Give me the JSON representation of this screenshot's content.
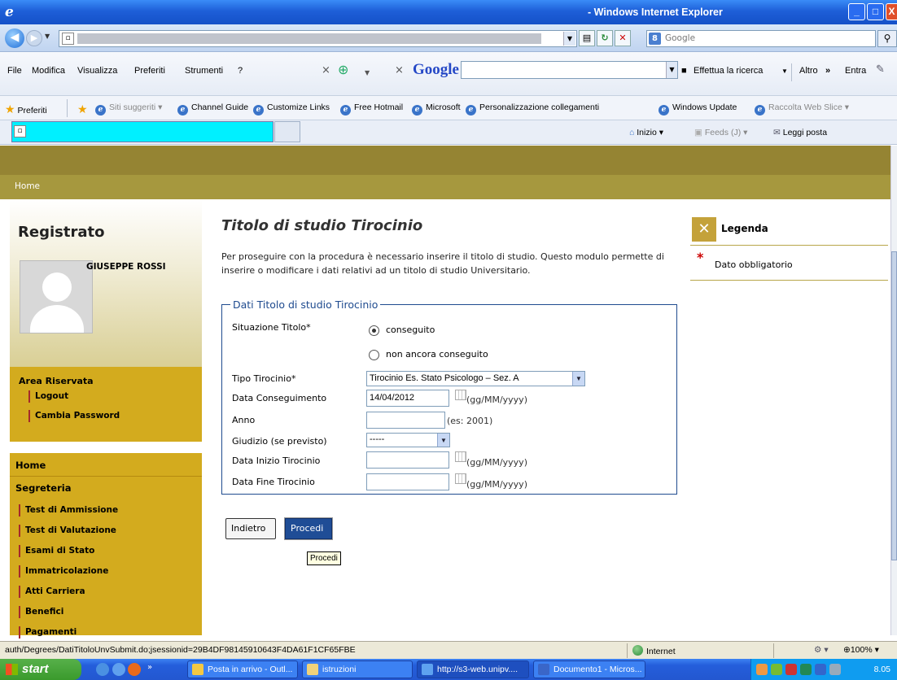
{
  "window": {
    "title": "- Windows Internet Explorer",
    "min_label": "_",
    "max_label": "□",
    "close_label": "X"
  },
  "addressbar": {
    "search_placeholder": "Google",
    "google_badge": "8"
  },
  "menubar": {
    "items": [
      "File",
      "Modifica",
      "Visualizza",
      "Preferiti",
      "Strumenti",
      "?"
    ],
    "google_label": "Google",
    "search_action": "Effettua la ricerca",
    "altro": "Altro",
    "entra": "Entra"
  },
  "favorites": {
    "label": "Preferiti",
    "items": [
      {
        "label": "Siti suggeriti",
        "dim": true
      },
      {
        "label": "Channel Guide",
        "dim": false
      },
      {
        "label": "Customize Links",
        "dim": false
      },
      {
        "label": "Free Hotmail",
        "dim": false
      },
      {
        "label": "Microsoft",
        "dim": false
      },
      {
        "label": "Personalizzazione collegamenti",
        "dim": false
      },
      {
        "label": "Windows Update",
        "dim": false
      },
      {
        "label": "Raccolta Web Slice",
        "dim": true
      }
    ]
  },
  "commandbar": {
    "home": "Inizio",
    "feeds": "Feeds (J)",
    "mail": "Leggi posta"
  },
  "page": {
    "breadcrumb": "Home",
    "sidebar": {
      "heading": "Registrato",
      "user_name": "GIUSEPPE ROSSI",
      "area_title": "Area Riservata",
      "area_links": [
        "Logout",
        "Cambia Password"
      ],
      "menu_home": "Home",
      "menu_section": "Segreteria",
      "menu_links": [
        "Test di Ammissione",
        "Test di Valutazione",
        "Esami di Stato",
        "Immatricolazione",
        "Atti Carriera",
        "Benefici",
        "Pagamenti"
      ]
    },
    "title": "Titolo di studio Tirocinio",
    "description": "Per proseguire con la procedura è necessario inserire il titolo di studio. Questo modulo permette di inserire o modificare i dati relativi ad un titolo di studio Universitario.",
    "form": {
      "legend": "Dati Titolo di studio Tirocinio",
      "situazione_label": "Situazione Titolo*",
      "radio_conseguito": "conseguito",
      "radio_non_conseguito": "non ancora conseguito",
      "tipo_label": "Tipo Tirocinio*",
      "tipo_value": "Tirocinio Es. Stato Psicologo – Sez. A",
      "data_cons_label": "Data Conseguimento",
      "data_cons_value": "14/04/2012",
      "date_hint": "(gg/MM/yyyy)",
      "anno_label": "Anno",
      "anno_hint": "(es: 2001)",
      "giudizio_label": "Giudizio (se previsto)",
      "giudizio_value": "-----",
      "inizio_label": "Data Inizio Tirocinio",
      "fine_label": "Data Fine Tirocinio"
    },
    "buttons": {
      "back": "Indietro",
      "next": "Procedi",
      "tooltip": "Procedi"
    },
    "legenda": {
      "title": "Legenda",
      "required": "Dato obbligatorio"
    }
  },
  "statusbar": {
    "url": "auth/Degrees/DatiTitoloUnvSubmit.do;jsessionid=29B4DF98145910643F4DA61F1CF65FBE",
    "zone": "Internet",
    "zoom": "100%"
  },
  "taskbar": {
    "start": "start",
    "tasks": [
      {
        "label": "Posta in arrivo - Outl...",
        "active": false
      },
      {
        "label": "istruzioni",
        "active": false
      },
      {
        "label": "http://s3-web.unipv....",
        "active": true
      },
      {
        "label": "Documento1 - Micros...",
        "active": false
      }
    ],
    "clock": "8.05"
  }
}
